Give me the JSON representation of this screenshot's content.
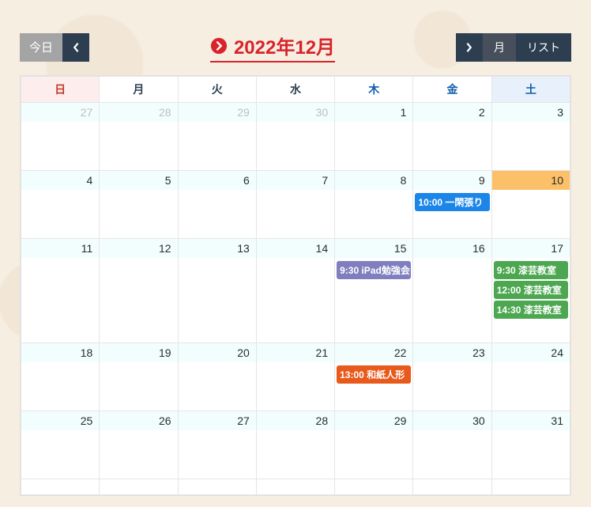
{
  "toolbar": {
    "today_label": "今日",
    "month_label": "月",
    "list_label": "リスト"
  },
  "title": "2022年12月",
  "day_headers": [
    "日",
    "月",
    "火",
    "水",
    "木",
    "金",
    "土"
  ],
  "weeks": [
    [
      {
        "num": "27",
        "other": true
      },
      {
        "num": "28",
        "other": true
      },
      {
        "num": "29",
        "other": true
      },
      {
        "num": "30",
        "other": true
      },
      {
        "num": "1"
      },
      {
        "num": "2"
      },
      {
        "num": "3"
      }
    ],
    [
      {
        "num": "4"
      },
      {
        "num": "5"
      },
      {
        "num": "6"
      },
      {
        "num": "7"
      },
      {
        "num": "8"
      },
      {
        "num": "9",
        "events": [
          {
            "time": "10:00",
            "title": "一閑張り",
            "color": "blue"
          }
        ]
      },
      {
        "num": "10",
        "today": true
      }
    ],
    [
      {
        "num": "11"
      },
      {
        "num": "12"
      },
      {
        "num": "13"
      },
      {
        "num": "14"
      },
      {
        "num": "15",
        "events": [
          {
            "time": "9:30",
            "title": "iPad勉強会",
            "color": "purple"
          }
        ]
      },
      {
        "num": "16"
      },
      {
        "num": "17",
        "events": [
          {
            "time": "9:30",
            "title": "漆芸教室",
            "color": "green"
          },
          {
            "time": "12:00",
            "title": "漆芸教室",
            "color": "green"
          },
          {
            "time": "14:30",
            "title": "漆芸教室",
            "color": "green"
          }
        ]
      }
    ],
    [
      {
        "num": "18"
      },
      {
        "num": "19"
      },
      {
        "num": "20"
      },
      {
        "num": "21"
      },
      {
        "num": "22",
        "events": [
          {
            "time": "13:00",
            "title": "和紙人形",
            "color": "orange"
          }
        ]
      },
      {
        "num": "23"
      },
      {
        "num": "24"
      }
    ],
    [
      {
        "num": "25"
      },
      {
        "num": "26"
      },
      {
        "num": "27"
      },
      {
        "num": "28"
      },
      {
        "num": "29"
      },
      {
        "num": "30"
      },
      {
        "num": "31"
      }
    ]
  ]
}
